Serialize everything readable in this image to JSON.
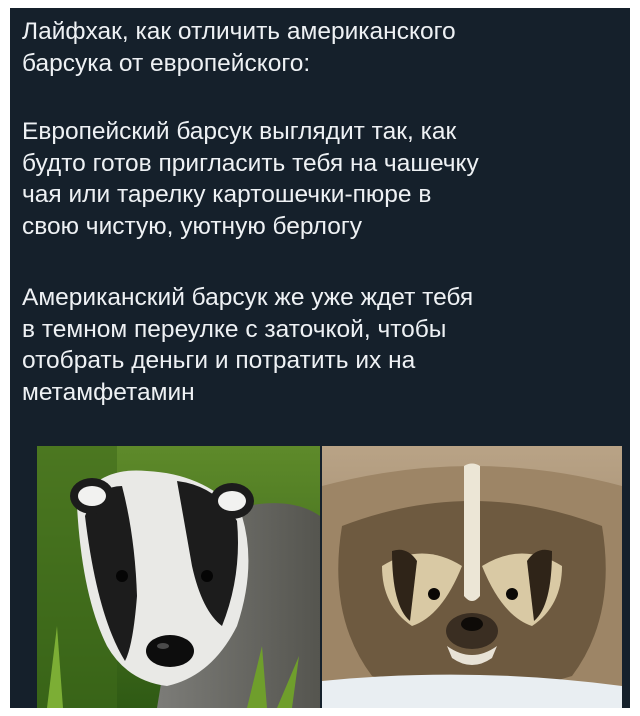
{
  "post": {
    "title": "Лайфхак, как отличить американского\nбарсука от европейского:",
    "paragraph_european": "Европейский барсук выглядит так, как\nбудто готов пригласить тебя на чашечку\nчая или тарелку картошечки-пюре в\nсвою чистую, уютную берлогу",
    "paragraph_american": "Американский барсук же уже ждет тебя\nв темном переулке с заточкой, чтобы\nотобрать деньги и потратить их на\nметамфетамин"
  },
  "colors": {
    "background": "#15202b",
    "text": "#eef1f4"
  }
}
